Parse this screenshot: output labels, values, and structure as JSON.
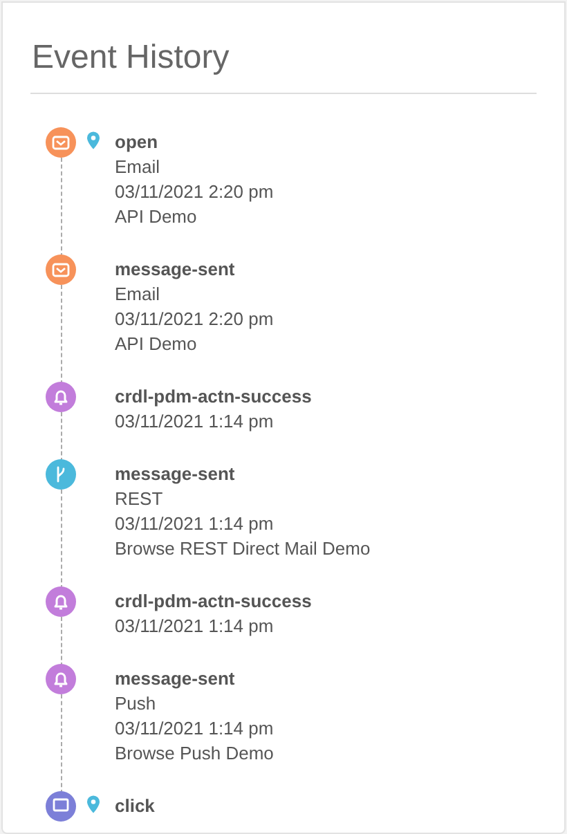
{
  "title": "Event History",
  "events": [
    {
      "kind": "email",
      "located": true,
      "name": "open",
      "lines": [
        "Email",
        "03/11/2021 2:20 pm",
        "API Demo"
      ]
    },
    {
      "kind": "email",
      "located": false,
      "name": "message-sent",
      "lines": [
        "Email",
        "03/11/2021 2:20 pm",
        "API Demo"
      ]
    },
    {
      "kind": "push",
      "located": false,
      "name": "crdl-pdm-actn-success",
      "lines": [
        "03/11/2021 1:14 pm"
      ]
    },
    {
      "kind": "rest",
      "located": false,
      "name": "message-sent",
      "lines": [
        "REST",
        "03/11/2021 1:14 pm",
        "Browse REST Direct Mail Demo"
      ]
    },
    {
      "kind": "push",
      "located": false,
      "name": "crdl-pdm-actn-success",
      "lines": [
        "03/11/2021 1:14 pm"
      ]
    },
    {
      "kind": "push",
      "located": false,
      "name": "message-sent",
      "lines": [
        "Push",
        "03/11/2021 1:14 pm",
        "Browse Push Demo"
      ]
    },
    {
      "kind": "message",
      "located": true,
      "name": "click"
    }
  ]
}
